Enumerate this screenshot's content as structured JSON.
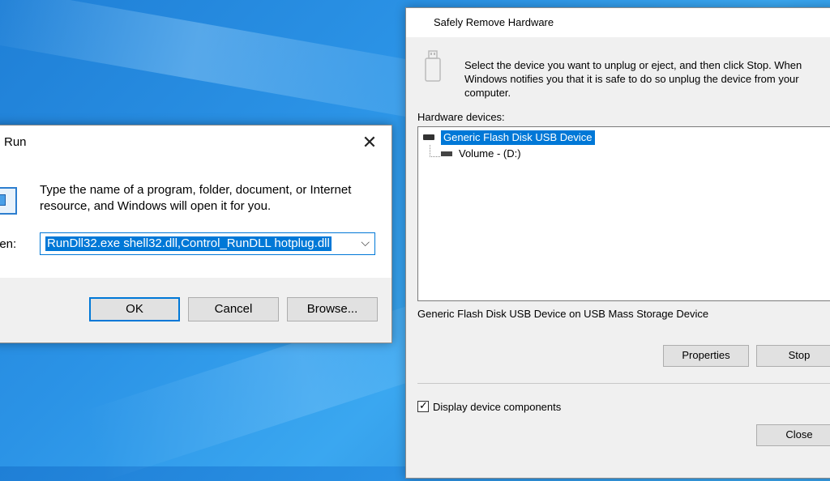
{
  "run_dialog": {
    "title": "Run",
    "close_glyph": "✕",
    "description": "Type the name of a program, folder, document, or Internet resource, and Windows will open it for you.",
    "open_label": "pen:",
    "command_value": "RunDll32.exe shell32.dll,Control_RunDLL hotplug.dll",
    "dropdown_glyph": "⌵",
    "ok_label": "OK",
    "cancel_label": "Cancel",
    "browse_label": "Browse...",
    "icon": "run-icon"
  },
  "safely_remove": {
    "title": "Safely Remove Hardware",
    "icon": "usb-drive-icon",
    "description": "Select the device you want to unplug or eject, and then click Stop. When Windows notifies you that it is safe to do so unplug the device from your computer.",
    "hardware_label": "Hardware devices:",
    "devices": [
      {
        "label": "Generic Flash Disk USB Device",
        "selected": true
      },
      {
        "label": "Volume - (D:)",
        "selected": false
      }
    ],
    "status_text": "Generic Flash Disk USB Device on USB Mass Storage Device",
    "properties_label": "Properties",
    "stop_label": "Stop",
    "display_components_label": "Display device components",
    "display_components_checked": true,
    "close_label": "Close"
  },
  "colors": {
    "accent": "#0078d7",
    "desktop": "#2b93e6",
    "dialog_bg": "#f0f0f0"
  }
}
